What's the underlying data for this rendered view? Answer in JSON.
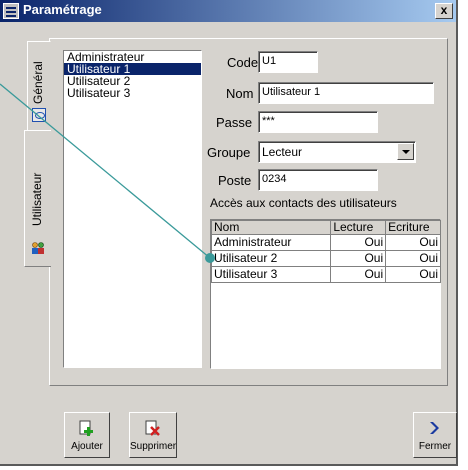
{
  "window": {
    "title": "Paramétrage",
    "close_glyph": "x"
  },
  "tabs": [
    {
      "label": "Général",
      "icon": "general-icon",
      "selected": false
    },
    {
      "label": "Utilisateur",
      "icon": "users-icon",
      "selected": true
    }
  ],
  "users": [
    {
      "name": "Administrateur",
      "selected": false
    },
    {
      "name": "Utilisateur 1",
      "selected": true
    },
    {
      "name": "Utilisateur 2",
      "selected": false
    },
    {
      "name": "Utilisateur 3",
      "selected": false
    }
  ],
  "form": {
    "code_label": "Code",
    "code_value": "U1",
    "nom_label": "Nom",
    "nom_value": "Utilisateur 1",
    "passe_label": "Passe",
    "passe_value": "***",
    "groupe_label": "Groupe",
    "groupe_value": "Lecteur",
    "poste_label": "Poste",
    "poste_value": "0234"
  },
  "access": {
    "title": "Accès aux contacts des utilisateurs",
    "columns": [
      "Nom",
      "Lecture",
      "Ecriture"
    ],
    "rows": [
      [
        "Administrateur",
        "Oui",
        "Oui"
      ],
      [
        "Utilisateur 2",
        "Oui",
        "Oui"
      ],
      [
        "Utilisateur 3",
        "Oui",
        "Oui"
      ]
    ]
  },
  "buttons": {
    "add_label": "Ajouter",
    "delete_label": "Supprimer",
    "close_label": "Fermer"
  },
  "colors": {
    "selection": "#0a246a",
    "callout": "#3a9a9a",
    "face": "#d6d3ce"
  }
}
